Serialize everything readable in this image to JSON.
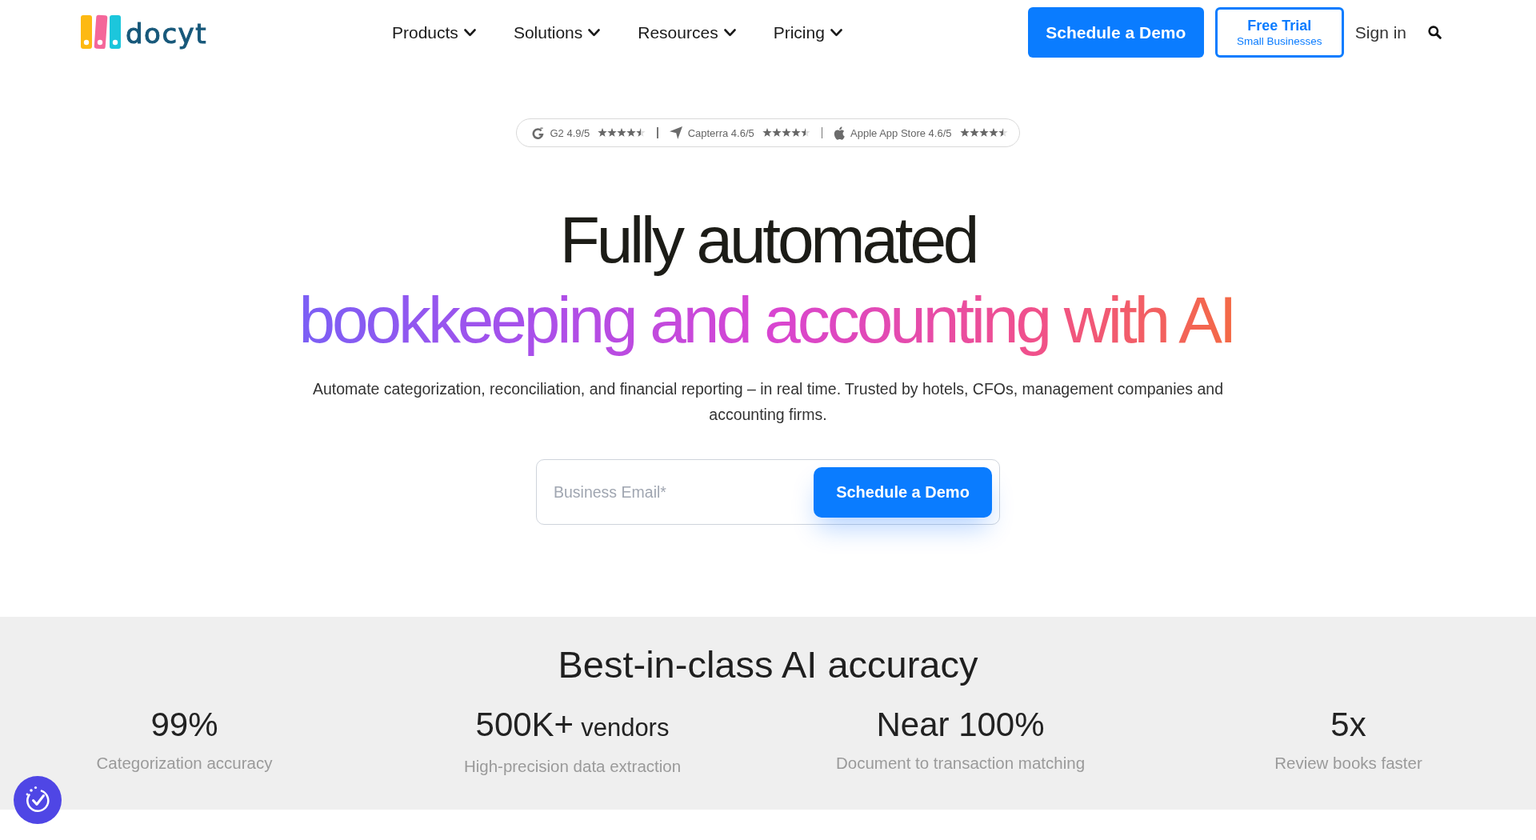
{
  "header": {
    "logo": {
      "text": "docyt"
    },
    "nav": [
      {
        "label": "Products",
        "dropdown": true
      },
      {
        "label": "Solutions",
        "dropdown": true
      },
      {
        "label": "Resources",
        "dropdown": true
      },
      {
        "label": "Pricing",
        "dropdown": true
      }
    ],
    "demo_button": "Schedule a Demo",
    "trial_button": {
      "title": "Free Trial",
      "subtitle": "Small Businesses"
    },
    "sign_in": "Sign in"
  },
  "ratings": [
    {
      "kind": "ring",
      "label": "G2 4.9/5",
      "stars": 4.5
    },
    {
      "kind": "arrow",
      "label": "Capterra 4.6/5",
      "stars": 4.5
    },
    {
      "kind": "apple",
      "label": "Apple App Store 4.6/5",
      "stars": 4.5
    }
  ],
  "hero": {
    "title": "Fully automated",
    "subtitle": "bookkeeping and accounting with AI",
    "description": "Automate categorization, reconciliation, and financial reporting – in real time. Trusted by hotels, CFOs, management companies and accounting firms.",
    "form": {
      "placeholder": "Business Email*",
      "button": "Schedule a Demo"
    }
  },
  "accuracy": {
    "title": "Best-in-class AI accuracy",
    "stats": [
      {
        "value": "99%",
        "label": "Categorization accuracy"
      },
      {
        "value": "500K+",
        "suffix": "vendors",
        "label": "High-precision data extraction"
      },
      {
        "value": "Near 100%",
        "label": "Document to transaction matching"
      },
      {
        "value": "5x",
        "label": "Review books faster"
      }
    ]
  }
}
